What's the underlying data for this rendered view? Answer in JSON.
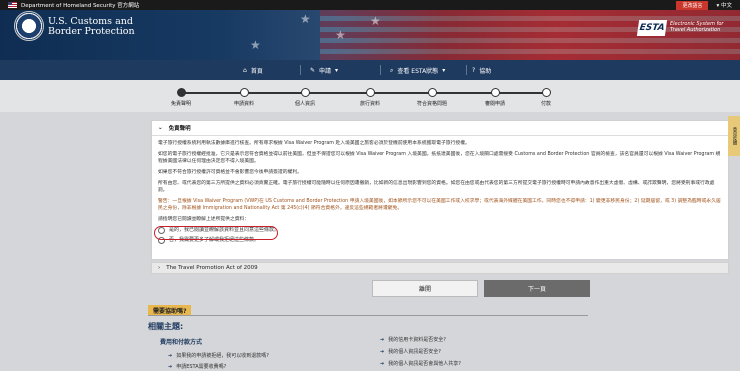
{
  "govbar": {
    "text": "Department of Homeland Security 官方網站",
    "lang_change": "更改語言",
    "lang_current": "中文"
  },
  "header": {
    "agency_line1": "U.S. Customs and",
    "agency_line2": "Border Protection",
    "esta_logo": "ESTA",
    "esta_line1": "Electronic System for",
    "esta_line2": "Travel Authorization"
  },
  "nav": {
    "home": "首頁",
    "apply": "申請",
    "view_status": "查看 ESTA狀態",
    "help": "協助"
  },
  "steps": [
    "免責聲明",
    "申請資料",
    "個人資訊",
    "旅行資料",
    "符合資格問題",
    "審閱申請",
    "付款"
  ],
  "panel": {
    "title": "免責聲明",
    "p1": "電子旅行授權系統利用執法數據庫進行核查。所有尋求根據 Visa Waiver Program 赴入境美國之旅客必須於登機前使用本系統獲取電子旅行授權。",
    "p2": "如您的電子旅行授權經批准，它只是表示您符合資格並得以前往美國，但並不保證您可以根據 Visa Waiver Program 入境美國。抵抵達美國後，您在入境關口處需接受 Customs and Border Protection 官員的檢查，該名官員還可以根據 Visa Waiver Program 規程據美國法律以任何理由決定您不得入境美國。",
    "p3": "如果您不符合旅行授權許可資格並不會影響您今後申請簽證的權利。",
    "p4": "所有由您、或代表您的第三方所提供之資料必須真實正確。電子旅行授權可能隨時以任何原因遭撤銷，比如新的信息出現影響到您的資格。如您在由您或由代表您的第三方所提交電子旅行授權時可申請內故意作出重大虛假、虛構、或詐欺聲明，您將受刑事或行政處罰。",
    "warning": "警告：一旦根據 Visa Waiver Program (VWP)在 US Customs and Border Protection 申請入境美國後，如本節所示您不可以在美國工作或入校求學；或代表海外媒體在美國工作，同時您也不得申請：1) 變更非移民身份；2) 延期居留，或 3) 調整為臨時或永久居民之身份，除非根據 Immigration and Nationality Act 第 245(c)(4) 節符合資格外，違反這些規範者將遭罷免。",
    "question": "請指明您已閱讀並瞭解上述所提供之資料：",
    "opt_yes": "是的，我已閱讀並瞭解該資料並且同意這些條款。",
    "opt_no": "否，我需要更多了解或我拒絕這些條款。"
  },
  "accordion": {
    "title": "The Travel Promotion Act of 2009"
  },
  "buttons": {
    "back": "離開",
    "next": "下一頁"
  },
  "side_tab": "意見反饋",
  "help": {
    "tab": "需要協助嗎?",
    "related": "相關主題:",
    "sub": "費用和付款方式",
    "links_left": [
      "如果我的申請被拒絕，我可以收到退款嗎?",
      "申請ESTA需要收費嗎?"
    ],
    "links_right": [
      "我的信用卡資料是否安全?",
      "我的個人資訊是否安全?",
      "我的個人資訊是否會與他人共享?"
    ]
  }
}
